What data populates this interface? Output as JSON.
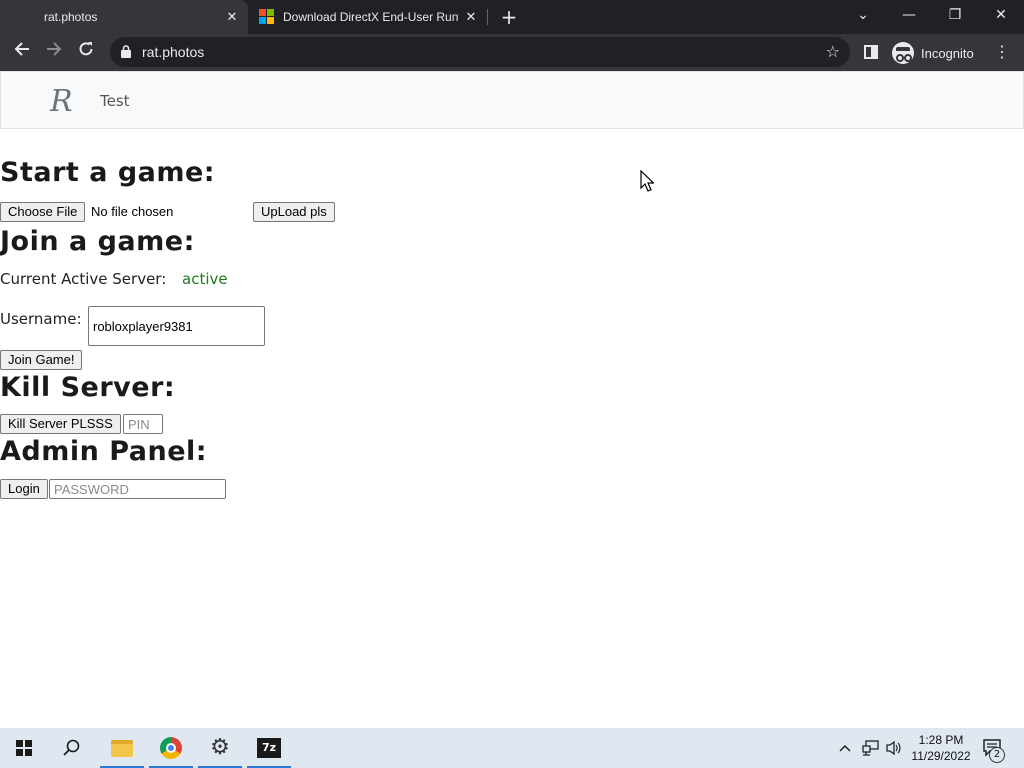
{
  "browser": {
    "tabs": [
      {
        "title": "rat.photos",
        "active": true
      },
      {
        "title": "Download DirectX End-User Runtime",
        "active": false
      }
    ],
    "url": "rat.photos",
    "profile_label": "Incognito",
    "icons": {
      "back": "arrow-left-icon",
      "forward": "arrow-right-icon",
      "reload": "reload-icon",
      "lock": "lock-icon",
      "bookmark": "star-icon",
      "side_panel": "side-panel-icon",
      "menu": "kebab-menu-icon"
    }
  },
  "navbar": {
    "brand": "R",
    "link": "Test"
  },
  "start_game": {
    "heading": "Start a game:",
    "choose_file_label": "Choose File",
    "file_status": "No file chosen",
    "upload_label": "UpLoad pls"
  },
  "join_game": {
    "heading": "Join a game:",
    "server_label": "Current Active Server:",
    "server_status": "active",
    "username_label": "Username:",
    "username_value": "robloxplayer9381",
    "join_label": "Join Game!"
  },
  "kill_server": {
    "heading": "Kill Server:",
    "button_label": "Kill Server PLSSS",
    "pin_placeholder": "PIN"
  },
  "admin_panel": {
    "heading": "Admin Panel:",
    "login_label": "Login",
    "password_placeholder": "PASSWORD"
  },
  "taskbar": {
    "time": "1:28 PM",
    "date": "11/29/2022",
    "notification_count": "2",
    "sevenzip_label": "7z"
  },
  "colors": {
    "active_status": "#1e7b1e",
    "chrome_dark": "#202124",
    "chrome_toolbar": "#35363a",
    "taskbar": "#dfe8f0"
  }
}
